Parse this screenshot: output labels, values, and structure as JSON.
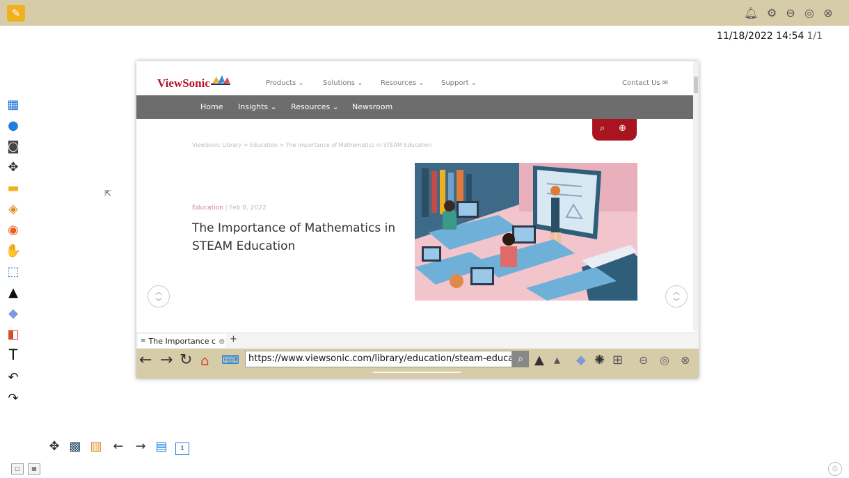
{
  "app": {
    "datetime": "11/18/2022 14:54",
    "page_indicator": "1/1",
    "accent": "#d6cca8"
  },
  "top_icons": [
    "bell-icon",
    "settings-icon",
    "minimize-icon",
    "restore-icon",
    "close-icon"
  ],
  "sidebar_icons": [
    "windows-icon",
    "group-icon",
    "screenshot-icon",
    "move-icon",
    "folder-icon",
    "box-icon",
    "browser-icon",
    "hand-icon",
    "select-icon",
    "pen-icon",
    "eraser-icon",
    "shapes-icon",
    "text-icon",
    "undo-icon",
    "redo-icon"
  ],
  "site": {
    "logo": "ViewSonic",
    "nav": [
      "Products",
      "Solutions",
      "Resources",
      "Support"
    ],
    "contact": "Contact Us",
    "gray_nav": [
      "Home",
      "Insights",
      "Resources",
      "Newsroom"
    ],
    "breadcrumb": "ViewSonic Library > Education > The Importance of Mathematics in STEAM Education",
    "category": "Education",
    "date": "Feb 8, 2022",
    "title": "The Importance of Mathematics in STEAM Education",
    "brand_color": "#b8102a"
  },
  "browser": {
    "tab_title": "The Importance c",
    "new_tab": "+",
    "url": "https://www.viewsonic.com/library/education/steam-education"
  },
  "text_tool_label": "T",
  "page_thumb_label": "1"
}
